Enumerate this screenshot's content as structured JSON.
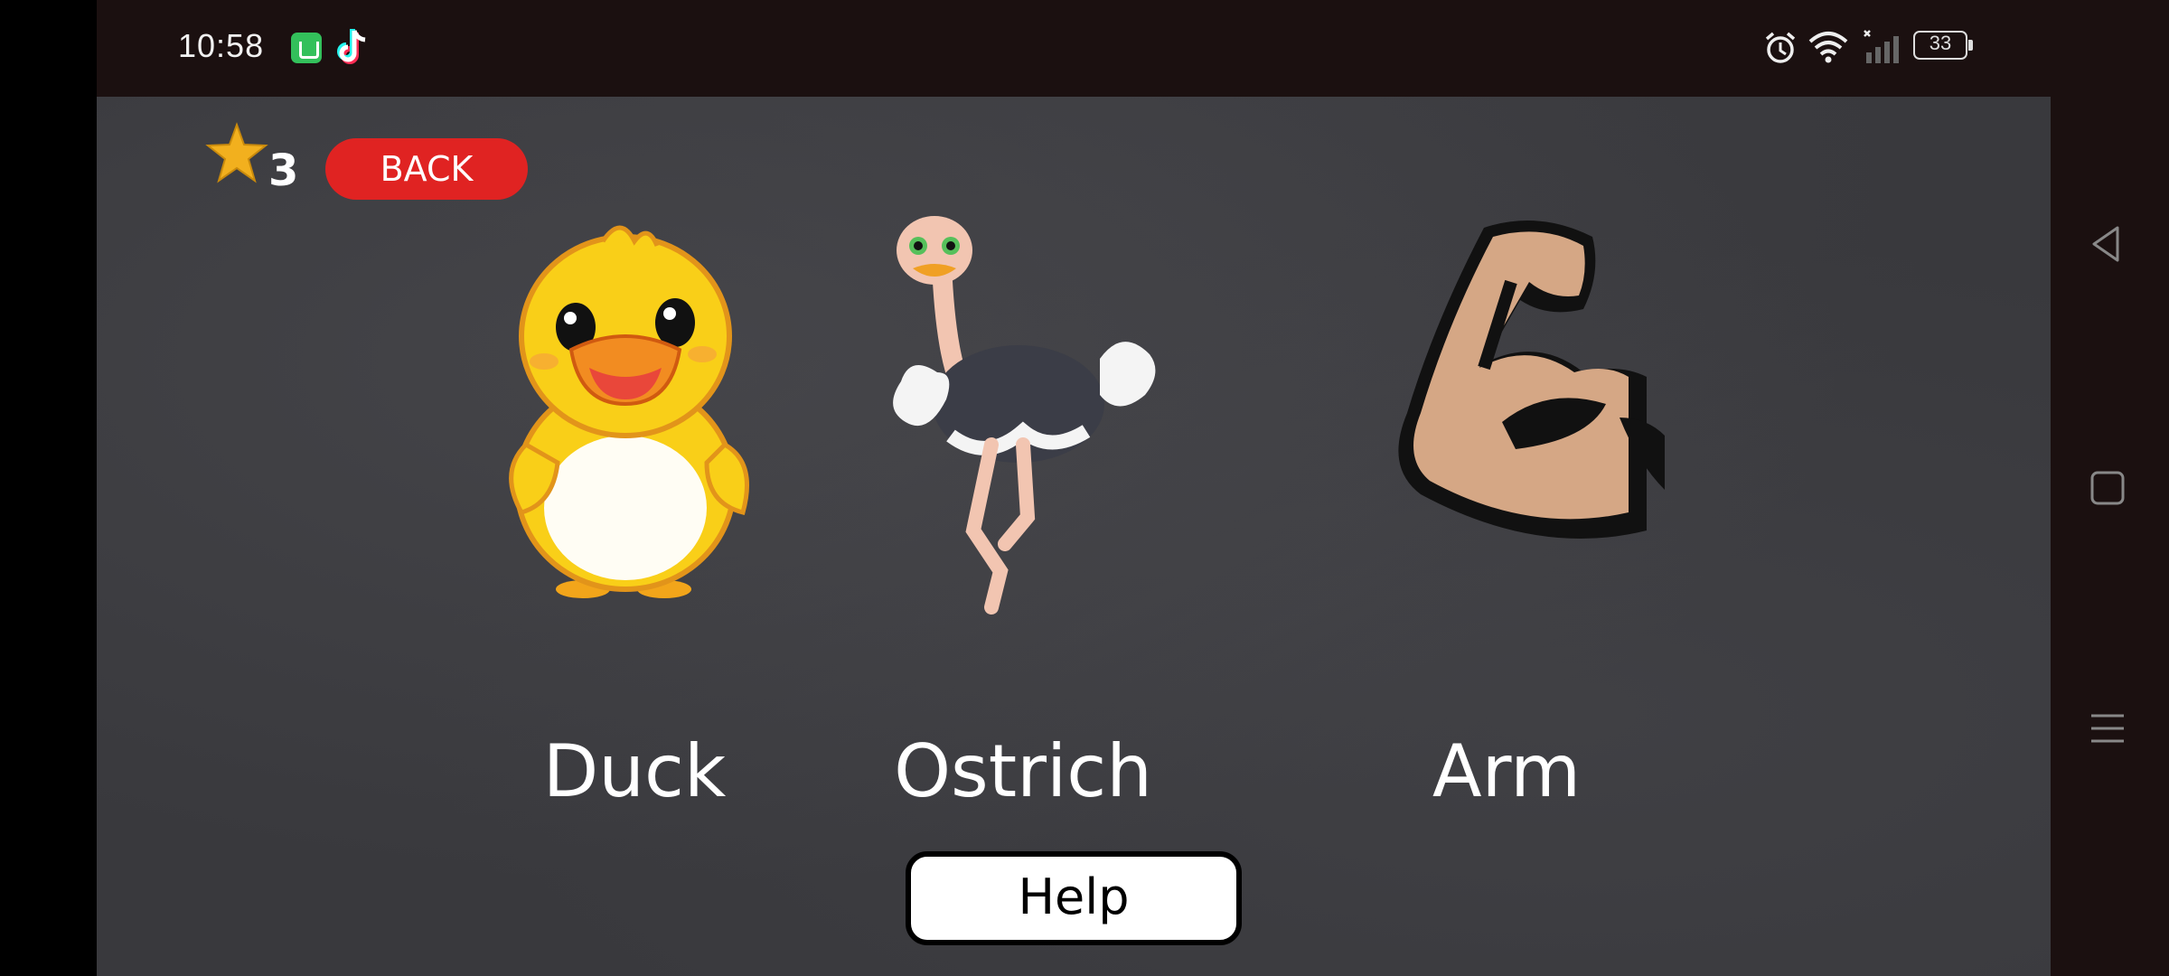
{
  "status_bar": {
    "time": "10:58",
    "notification_icons": [
      "shopping-bag-icon",
      "tiktok-icon"
    ],
    "system_icons": [
      "alarm-icon",
      "wifi-icon",
      "signal-icon",
      "battery-icon"
    ],
    "battery_level": "33"
  },
  "game": {
    "score": "3",
    "back_label": "BACK",
    "help_label": "Help",
    "cards": [
      {
        "label": "Duck",
        "icon": "duck-icon"
      },
      {
        "label": "Ostrich",
        "icon": "ostrich-icon"
      },
      {
        "label": "Arm",
        "icon": "arm-icon"
      }
    ]
  },
  "navigation": {
    "buttons": [
      "back-icon",
      "home-icon",
      "menu-icon"
    ]
  },
  "colors": {
    "back_button": "#e02322",
    "star": "#f2b01e",
    "background": "#39393d",
    "status_bar": "#1b1010"
  }
}
